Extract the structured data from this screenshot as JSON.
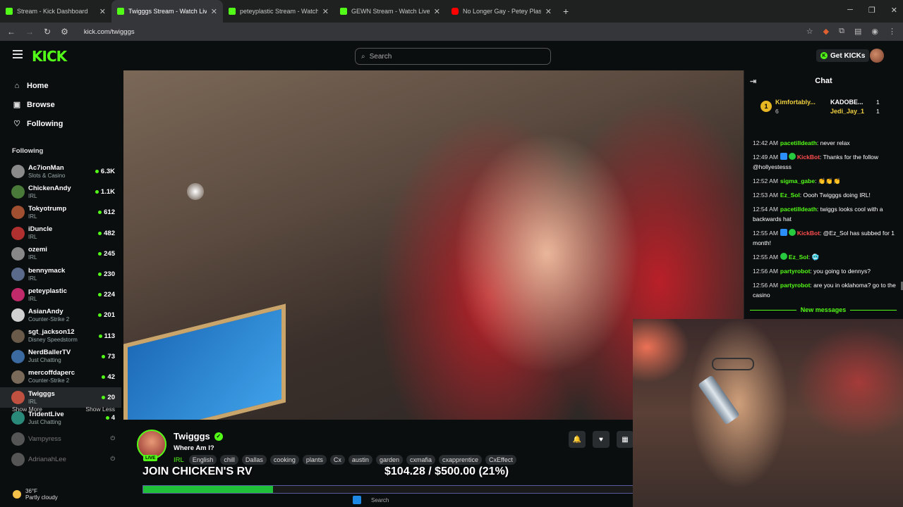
{
  "browser": {
    "tabs": [
      {
        "title": "Stream - Kick Dashboard",
        "icon": "kick-icon"
      },
      {
        "title": "Twigggs Stream - Watch Live",
        "icon": "kick-icon"
      },
      {
        "title": "peteyplastic Stream - Watch Live",
        "icon": "kick-icon"
      },
      {
        "title": "GEWN Stream - Watch Live on",
        "icon": "kick-icon"
      },
      {
        "title": "No Longer Gay - Petey Plastic -",
        "icon": "youtube-icon"
      }
    ],
    "url": "kick.com/twigggs"
  },
  "header": {
    "logo": "KICK",
    "search_placeholder": "Search",
    "get_kicks_label": "Get KICKs"
  },
  "sidebar": {
    "nav": [
      {
        "label": "Home",
        "icon": "home-icon"
      },
      {
        "label": "Browse",
        "icon": "browse-icon"
      },
      {
        "label": "Following",
        "icon": "heart-icon"
      }
    ],
    "following_title": "Following",
    "channels": [
      {
        "name": "Ac7ionMan",
        "category": "Slots & Casino",
        "viewers": "6.3K",
        "color": "#8a8a8a"
      },
      {
        "name": "ChickenAndy",
        "category": "IRL",
        "viewers": "1.1K",
        "color": "#4a7a3a"
      },
      {
        "name": "Tokyotrump",
        "category": "IRL",
        "viewers": "612",
        "color": "#a05030"
      },
      {
        "name": "iDuncle",
        "category": "IRL",
        "viewers": "482",
        "color": "#b03030"
      },
      {
        "name": "ozemi",
        "category": "IRL",
        "viewers": "245",
        "color": "#888888"
      },
      {
        "name": "bennymack",
        "category": "IRL",
        "viewers": "230",
        "color": "#5a6a8a"
      },
      {
        "name": "peteyplastic",
        "category": "IRL",
        "viewers": "224",
        "color": "#c02a6a"
      },
      {
        "name": "AsianAndy",
        "category": "Counter-Strike 2",
        "viewers": "201",
        "color": "#d0d0d0"
      },
      {
        "name": "sgt_jackson12",
        "category": "Disney Speedstorm",
        "viewers": "113",
        "color": "#6a5a4a"
      },
      {
        "name": "NerdBallerTV",
        "category": "Just Chatting",
        "viewers": "73",
        "color": "#3a6aa0"
      },
      {
        "name": "mercoffdaperc",
        "category": "Counter-Strike 2",
        "viewers": "42",
        "color": "#7a6a5a"
      },
      {
        "name": "Twigggs",
        "category": "IRL",
        "viewers": "20",
        "color": "#c05040"
      },
      {
        "name": "TridentLive",
        "category": "Just Chatting",
        "viewers": "4",
        "color": "#2a8a7a"
      }
    ],
    "offline": [
      {
        "name": "Vampyress",
        "color": "#555555"
      },
      {
        "name": "AdrianahLee",
        "color": "#555555"
      }
    ],
    "show_more": "Show More",
    "show_less": "Show Less",
    "weather_temp": "36°F",
    "weather_desc": "Partly cloudy"
  },
  "stream": {
    "channel": "Twigggs",
    "title": "Where Am I?",
    "live_label": "LIVE",
    "category": "IRL",
    "tags": [
      "English",
      "chill",
      "Dallas",
      "cooking",
      "plants",
      "Cx",
      "austin",
      "garden",
      "cxmafia",
      "cxapprentice",
      "CxEffect"
    ]
  },
  "goal": {
    "text": "JOIN CHICKEN'S RV",
    "amount": "$104.28 / $500.00 (21%)",
    "progress": 0.21
  },
  "taskbar": {
    "search": "Search"
  },
  "chat": {
    "title": "Chat",
    "pinned": {
      "rank": "1",
      "top_user": "Kimfortably...",
      "top_count": "6",
      "user2": "KADOBE...",
      "user2_count": "1",
      "user3": "Jedi_Jay_1",
      "user3_count": "1"
    },
    "messages": [
      {
        "time": "12:42 AM",
        "user": "pacetilldeath",
        "color": "g",
        "badges": [],
        "text": "never relax"
      },
      {
        "time": "12:49 AM",
        "user": "KickBot",
        "color": "r",
        "badges": [
          "bl",
          "gr"
        ],
        "text": "Thanks for the follow @hollyestesss"
      },
      {
        "time": "12:52 AM",
        "user": "sigma_gabe",
        "color": "g",
        "badges": [],
        "text": "👏👏👏"
      },
      {
        "time": "12:53 AM",
        "user": "Ez_Sol",
        "color": "g",
        "badges": [],
        "text": "Oooh Twigggs doing IRL!"
      },
      {
        "time": "12:54 AM",
        "user": "pacetilldeath",
        "color": "g",
        "badges": [],
        "text": "twiggs looks cool with a backwards hat"
      },
      {
        "time": "12:55 AM",
        "user": "KickBot",
        "color": "r",
        "badges": [
          "bl",
          "gr"
        ],
        "text": "@Ez_Sol has subbed for 1 month!"
      },
      {
        "time": "12:55 AM",
        "user": "Ez_Sol",
        "color": "g",
        "badges": [
          "gr"
        ],
        "text": "🥶"
      },
      {
        "time": "12:56 AM",
        "user": "partyrobot",
        "color": "g",
        "badges": [],
        "text": "you going to dennys?"
      },
      {
        "time": "12:56 AM",
        "user": "partyrobot",
        "color": "g",
        "badges": [],
        "text": "are you in oklahoma? go to the casino"
      }
    ],
    "new_messages": "New messages"
  }
}
